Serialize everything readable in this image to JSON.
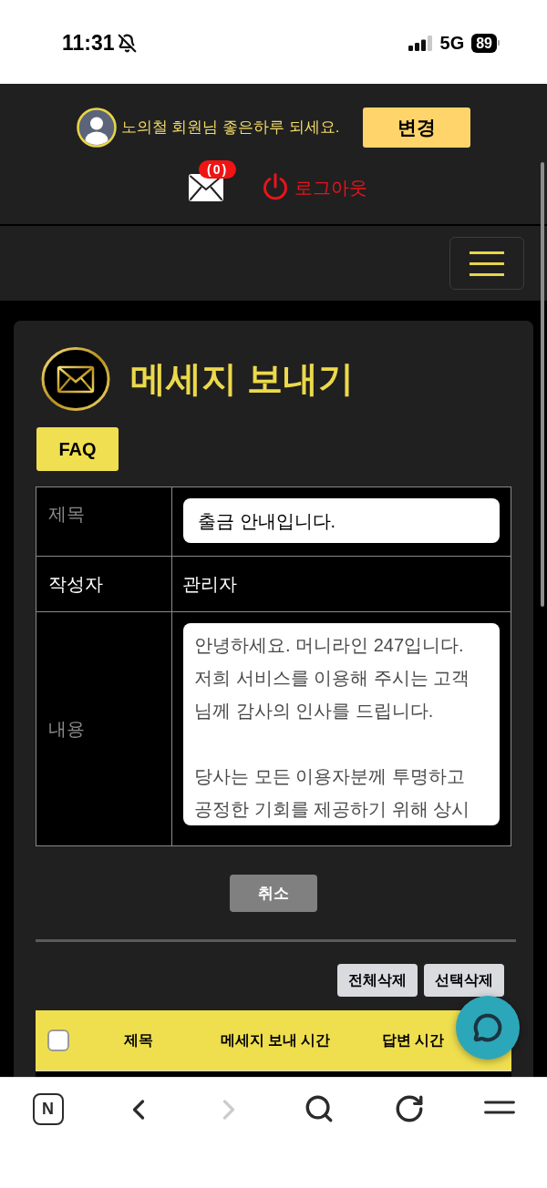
{
  "status_bar": {
    "time": "11:31",
    "network": "5G",
    "battery": "89"
  },
  "header": {
    "greeting": "노의철 회원님 좋은하루 되세요.",
    "change_button": "변경",
    "message_count": "(0)",
    "logout_button": "로그아웃"
  },
  "page": {
    "title": "메세지 보내기",
    "faq_button": "FAQ"
  },
  "form": {
    "rows": [
      {
        "kind": "input",
        "label": "제목",
        "value": "출금 안내입니다."
      },
      {
        "kind": "text",
        "label": "작성자",
        "value": "관리자"
      },
      {
        "kind": "textarea",
        "label": "내용",
        "paragraphs": [
          [
            "안녕하세요. 머니라인 247입니다.",
            "저희 서비스를 이용해 주시는 고객",
            "님께 감사의 인사를 드립니다."
          ],
          [
            "당사는 모든 이용자분께 투명하고",
            "공정한 기회를 제공하기 위해 상시"
          ]
        ]
      }
    ],
    "cancel_button": "취소"
  },
  "message_list": {
    "actions": [
      "전체삭제",
      "선택삭제"
    ],
    "select_all": {
      "checked": false
    },
    "columns": [
      "제목",
      "메세지 보내 시간",
      "답변 시간"
    ]
  },
  "browser_toolbar": {
    "home_button": "N",
    "forward_disabled": true
  }
}
